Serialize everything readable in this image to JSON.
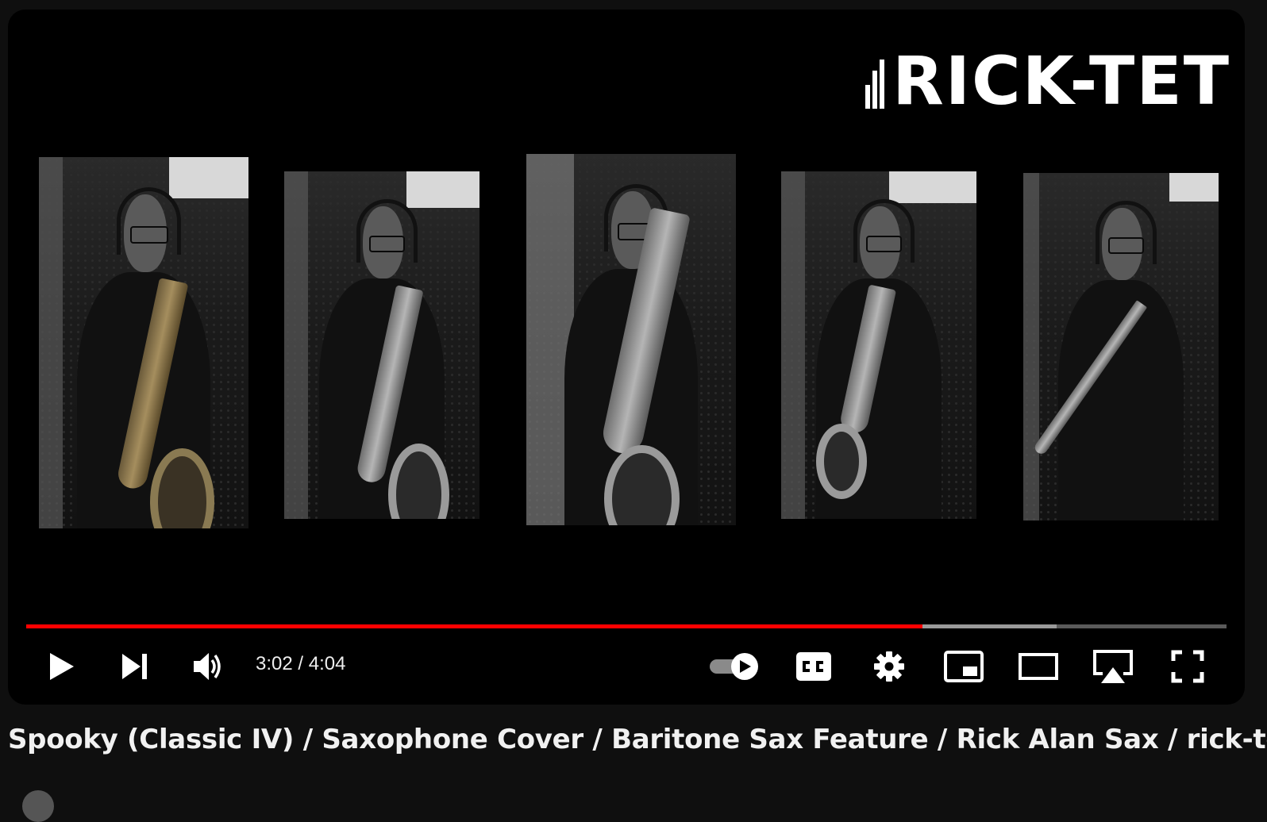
{
  "player": {
    "channel_logo_text": "RICK-TET",
    "current_time": "3:02",
    "separator": " / ",
    "duration": "4:04",
    "progress_played_fraction": 0.7464,
    "progress_buffered_fraction": 0.8582,
    "autoplay_enabled": true,
    "colors": {
      "progress_played": "#ff0000",
      "progress_buffered": "#9a9a9a",
      "progress_track": "#5a5a5a",
      "background": "#000000"
    },
    "controls": {
      "play_icon": "play-icon",
      "next_icon": "next-icon",
      "volume_icon": "volume-icon",
      "autoplay_icon": "autoplay-toggle-icon",
      "captions_icon": "captions-icon",
      "settings_icon": "gear-icon",
      "miniplayer_icon": "miniplayer-icon",
      "theater_icon": "theater-mode-icon",
      "airplay_icon": "airplay-icon",
      "fullscreen_icon": "fullscreen-icon"
    }
  },
  "video": {
    "title": "Spooky (Classic IV) / Saxophone Cover / Baritone Sax Feature / Rick Alan Sax / rick-tet"
  }
}
